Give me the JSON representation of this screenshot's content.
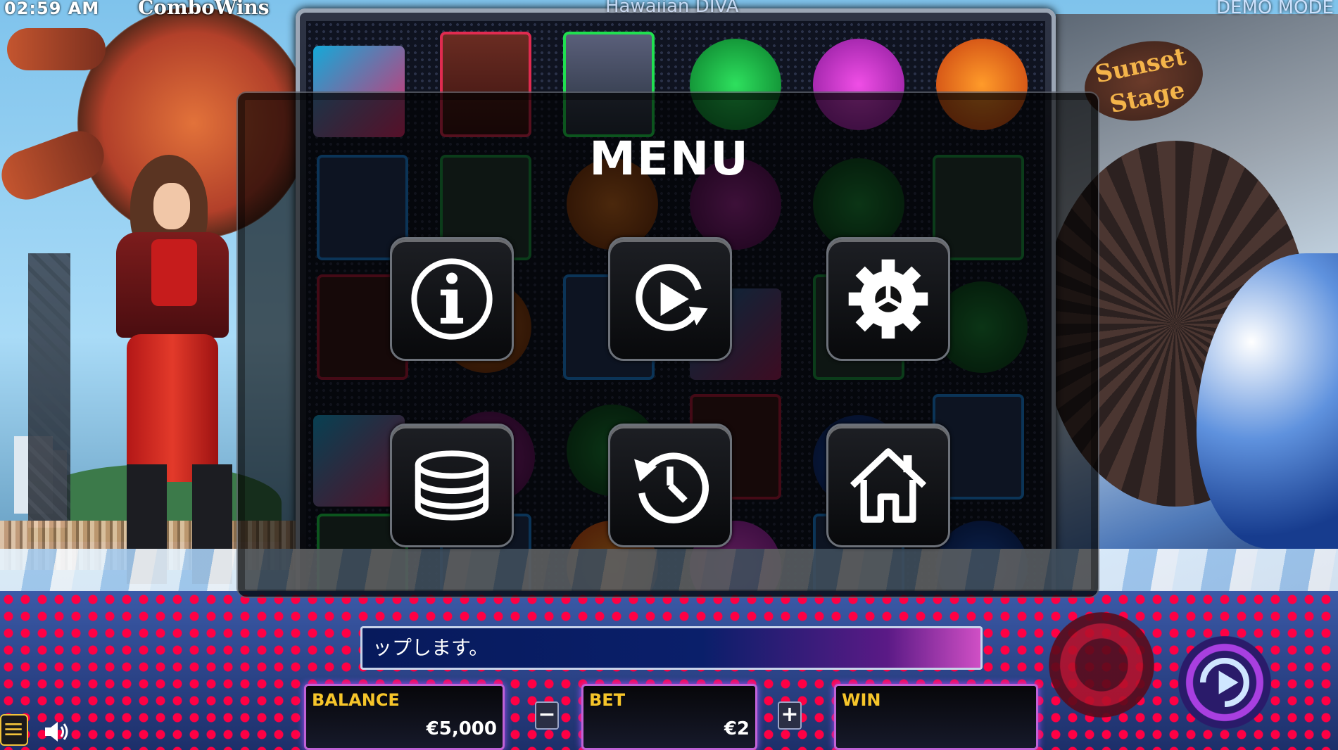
{
  "topbar": {
    "clock": "02:59 AM",
    "brand": "ComboWins",
    "game_title": "Hawaiian DIVA",
    "mode": "DEMO MODE"
  },
  "decor": {
    "stage_sign": "Sunset Stage"
  },
  "menu": {
    "title": "MENU",
    "buttons": [
      {
        "name": "info",
        "icon": "info-icon"
      },
      {
        "name": "autoplay",
        "icon": "autoplay-icon"
      },
      {
        "name": "settings",
        "icon": "gear-icon"
      },
      {
        "name": "bet",
        "icon": "coins-icon"
      },
      {
        "name": "history",
        "icon": "history-icon"
      },
      {
        "name": "home",
        "icon": "home-icon"
      }
    ]
  },
  "message": "ップします。",
  "panels": {
    "balance_label": "BALANCE",
    "balance_value": "€5,000",
    "bet_label": "BET",
    "bet_value": "€2",
    "win_label": "WIN",
    "win_value": "",
    "minus": "−",
    "plus": "+"
  },
  "colors": {
    "panel_border": "#c062d6",
    "label": "#f6c52a",
    "message_start": "#071a5c",
    "message_end": "#d04fc5"
  }
}
